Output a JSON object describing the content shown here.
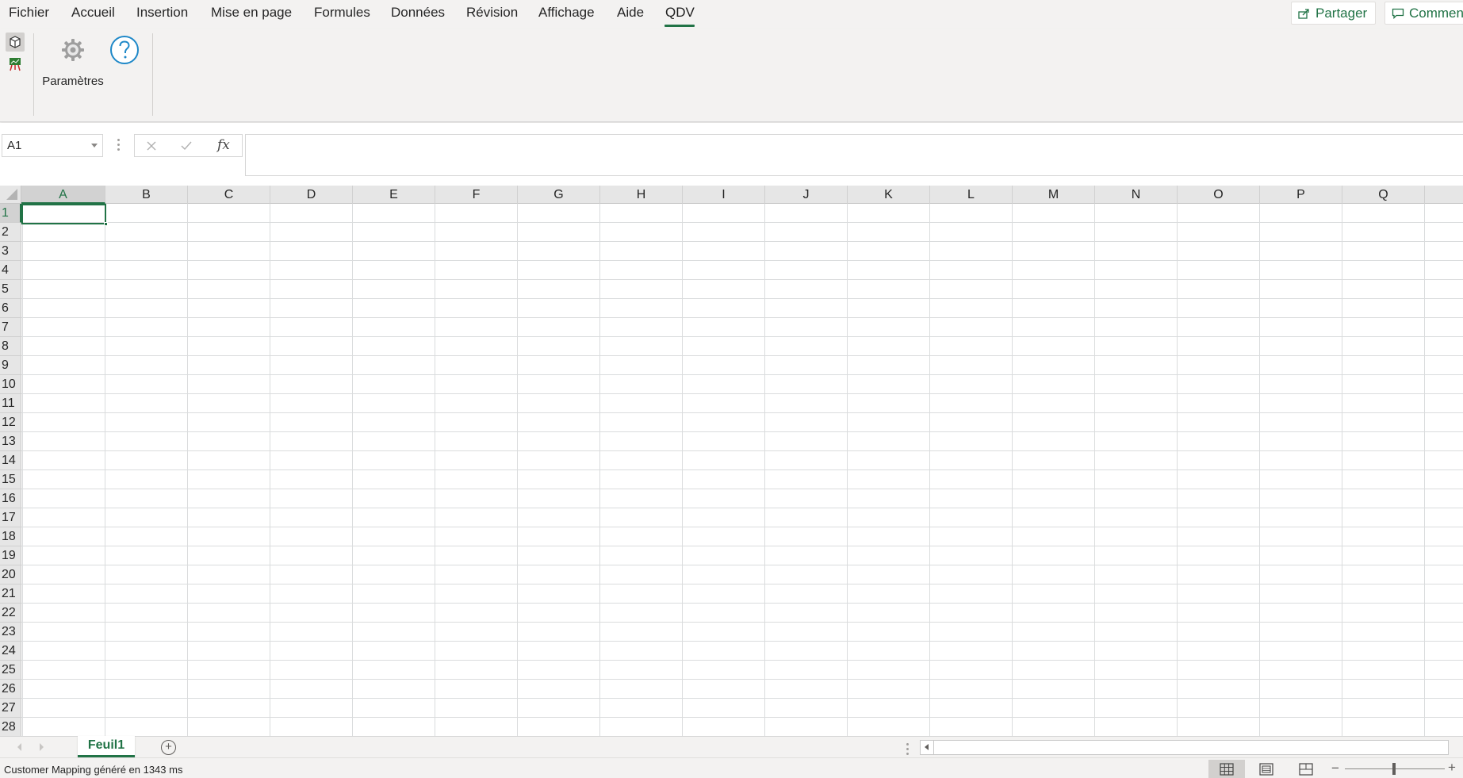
{
  "menu": {
    "items": [
      "Fichier",
      "Accueil",
      "Insertion",
      "Mise en page",
      "Formules",
      "Données",
      "Révision",
      "Affichage",
      "Aide",
      "QDV"
    ],
    "active": "QDV"
  },
  "top_buttons": {
    "share_label": "Partager",
    "comments_label": "Commentaires"
  },
  "ribbon": {
    "params_label": "Paramètres"
  },
  "formula_bar": {
    "name_box": "A1",
    "fx_label": "fx",
    "formula_value": ""
  },
  "grid": {
    "columns": [
      "A",
      "B",
      "C",
      "D",
      "E",
      "F",
      "G",
      "H",
      "I",
      "J",
      "K",
      "L",
      "M",
      "N",
      "O",
      "P",
      "Q"
    ],
    "rows": [
      "1",
      "2",
      "3",
      "4",
      "5",
      "6",
      "7",
      "8",
      "9",
      "10",
      "11",
      "12",
      "13",
      "14",
      "15",
      "16",
      "17",
      "18",
      "19",
      "20",
      "21",
      "22",
      "23",
      "24",
      "25",
      "26",
      "27",
      "28"
    ],
    "selected_cell": "A1"
  },
  "sheets": {
    "tabs": [
      "Feuil1"
    ],
    "add_label": "+"
  },
  "status": {
    "text": "Customer Mapping généré en 1343 ms",
    "zoom_minus": "−",
    "zoom_plus": "+"
  },
  "colors": {
    "accent": "#217346",
    "chrome": "#f3f2f1",
    "gridline": "#dadcdd"
  }
}
